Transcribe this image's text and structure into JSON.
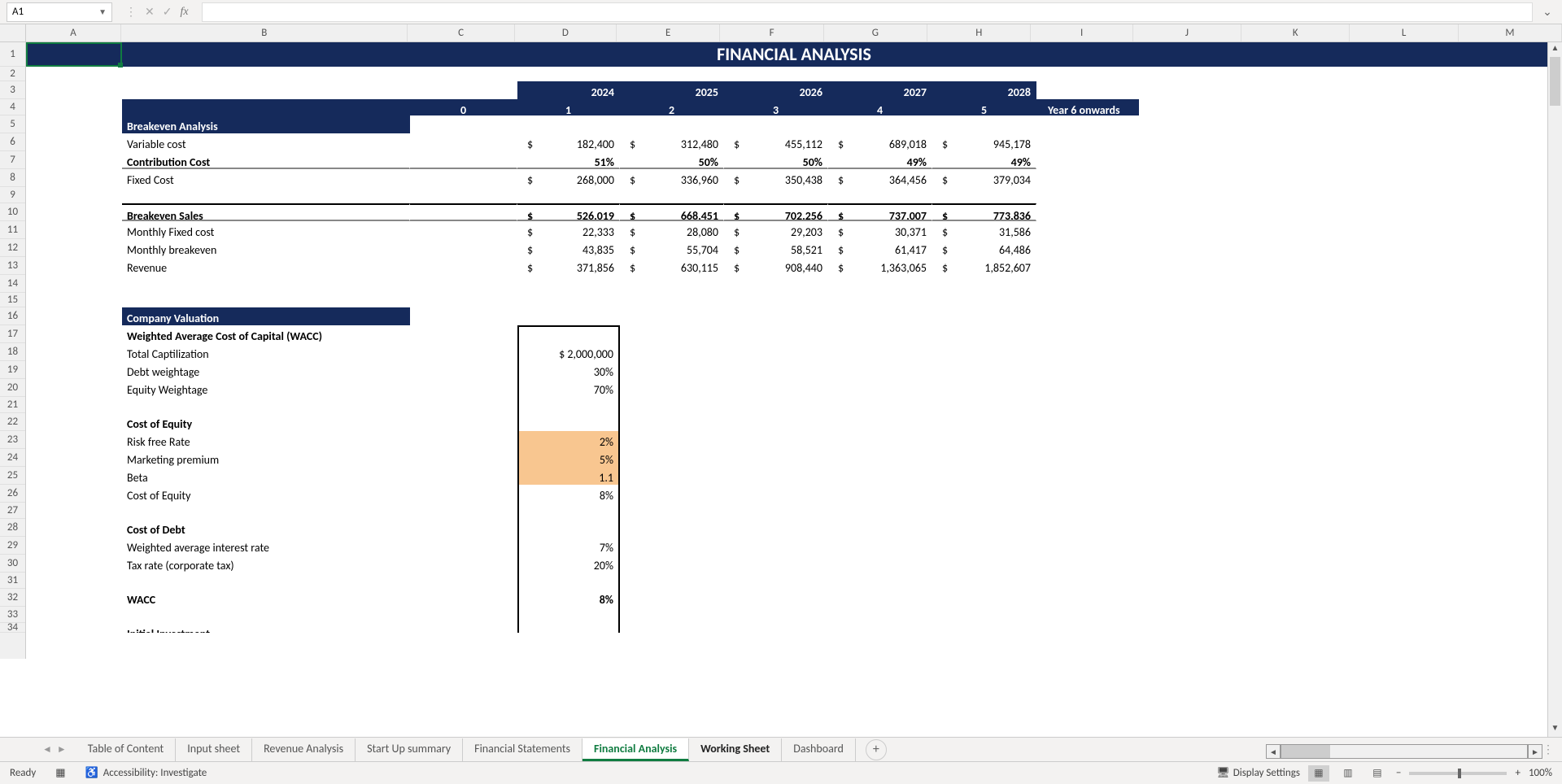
{
  "formula_bar": {
    "name_box": "A1",
    "fx": "fx",
    "cancel": "✕",
    "confirm": "✓"
  },
  "columns": [
    "A",
    "B",
    "C",
    "D",
    "E",
    "F",
    "G",
    "H",
    "I",
    "J",
    "K",
    "L",
    "M"
  ],
  "row_numbers": [
    "1",
    "2",
    "3",
    "4",
    "5",
    "6",
    "7",
    "8",
    "9",
    "10",
    "11",
    "12",
    "13",
    "14",
    "15",
    "16",
    "17",
    "18",
    "19",
    "20",
    "21",
    "22",
    "23",
    "24",
    "25",
    "26",
    "27",
    "28",
    "29",
    "30",
    "31",
    "32",
    "33",
    "34"
  ],
  "title": "FINANCIAL ANALYSIS",
  "years": [
    "2024",
    "2025",
    "2026",
    "2027",
    "2028"
  ],
  "year_idx_row": {
    "c": "0",
    "vals": [
      "1",
      "2",
      "3",
      "4",
      "5"
    ],
    "i_label": "Year 6 onwards"
  },
  "section1": {
    "header": "Breakeven Analysis",
    "rows": [
      {
        "label": "Variable cost",
        "vals": [
          "182,400",
          "312,480",
          "455,112",
          "689,018",
          "945,178"
        ],
        "money": true
      },
      {
        "label": "Contribution Cost",
        "vals": [
          "51%",
          "50%",
          "50%",
          "49%",
          "49%"
        ],
        "bold": true
      },
      {
        "label": "Fixed Cost",
        "vals": [
          "268,000",
          "336,960",
          "350,438",
          "364,456",
          "379,034"
        ],
        "money": true
      }
    ],
    "breakeven": {
      "label": "Breakeven Sales",
      "vals": [
        "526,019",
        "668,451",
        "702,256",
        "737,007",
        "773,836"
      ],
      "money": true,
      "bold": true
    },
    "after": [
      {
        "label": "Monthly Fixed cost",
        "vals": [
          "22,333",
          "28,080",
          "29,203",
          "30,371",
          "31,586"
        ],
        "money": true
      },
      {
        "label": "Monthly breakeven",
        "vals": [
          "43,835",
          "55,704",
          "58,521",
          "61,417",
          "64,486"
        ],
        "money": true
      },
      {
        "label": "Revenue",
        "vals": [
          "371,856",
          "630,115",
          "908,440",
          "1,363,065",
          "1,852,607"
        ],
        "money": true
      }
    ]
  },
  "section2": {
    "header": "Company Valuation",
    "wacc_title": "Weighted Average Cost of Capital (WACC)",
    "rows1": [
      {
        "label": "Total Captilization",
        "d": "$  2,000,000"
      },
      {
        "label": "Debt weightage",
        "d": "30%"
      },
      {
        "label": "Equity Weightage",
        "d": "70%"
      }
    ],
    "coe_title": "Cost of Equity",
    "rows2": [
      {
        "label": "Risk free Rate",
        "d": "2%",
        "peach": true
      },
      {
        "label": "Marketing premium",
        "d": "5%",
        "peach": true
      },
      {
        "label": "Beta",
        "d": "1.1",
        "peach": true
      },
      {
        "label": "Cost of Equity",
        "d": "8%"
      }
    ],
    "cod_title": "Cost of Debt",
    "rows3": [
      {
        "label": "Weighted average interest rate",
        "d": "7%"
      },
      {
        "label": "Tax rate (corporate tax)",
        "d": "20%"
      }
    ],
    "wacc": {
      "label": "WACC",
      "d": "8%"
    },
    "last": "Initial Investment"
  },
  "tabs": {
    "items": [
      "Table of Content",
      "Input sheet",
      "Revenue Analysis",
      "Start Up summary",
      "Financial Statements",
      "Financial Analysis",
      "Working Sheet",
      "Dashboard"
    ],
    "active_idx": 5,
    "bold_idx": 6
  },
  "status": {
    "ready": "Ready",
    "accessibility": "Accessibility: Investigate",
    "display": "Display Settings",
    "zoom": "100%"
  }
}
